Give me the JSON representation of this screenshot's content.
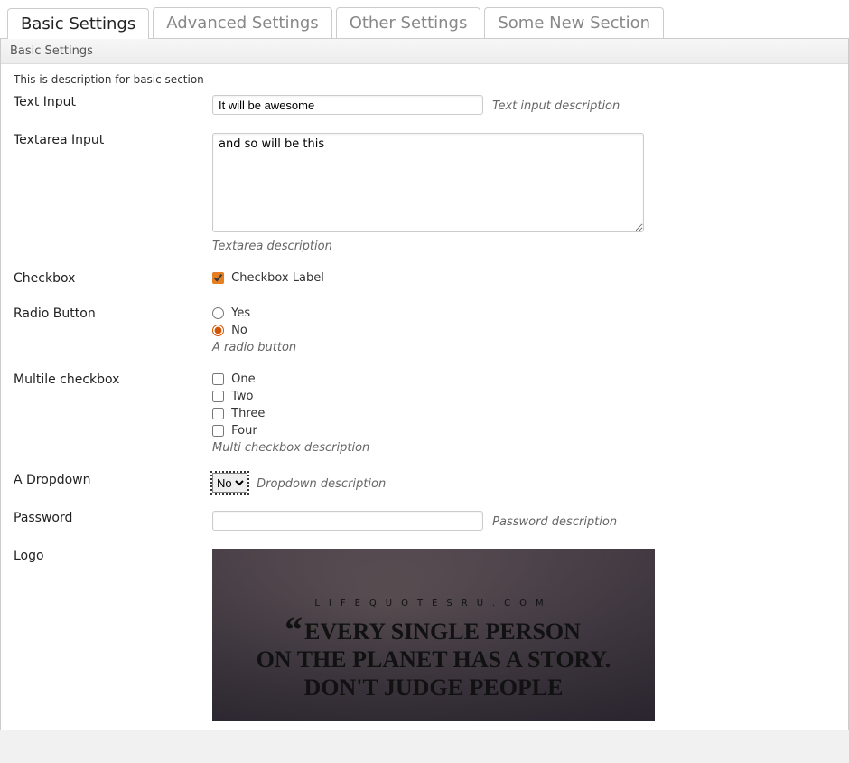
{
  "tabs": [
    {
      "label": "Basic Settings",
      "active": true
    },
    {
      "label": "Advanced Settings",
      "active": false
    },
    {
      "label": "Other Settings",
      "active": false
    },
    {
      "label": "Some New Section",
      "active": false
    }
  ],
  "section": {
    "title": "Basic Settings",
    "description": "This is description for basic section"
  },
  "fields": {
    "text": {
      "label": "Text Input",
      "value": "It will be awesome",
      "desc": "Text input description"
    },
    "textarea": {
      "label": "Textarea Input",
      "value": "and so will be this",
      "desc": "Textarea description"
    },
    "checkbox": {
      "label": "Checkbox",
      "option": "Checkbox Label",
      "checked": true
    },
    "radio": {
      "label": "Radio Button",
      "options": [
        {
          "label": "Yes",
          "checked": false
        },
        {
          "label": "No",
          "checked": true
        }
      ],
      "desc": "A radio button"
    },
    "multi": {
      "label": "Multile checkbox",
      "options": [
        {
          "label": "One",
          "checked": false
        },
        {
          "label": "Two",
          "checked": false
        },
        {
          "label": "Three",
          "checked": false
        },
        {
          "label": "Four",
          "checked": false
        }
      ],
      "desc": "Multi checkbox description"
    },
    "dropdown": {
      "label": "A Dropdown",
      "value": "No",
      "desc": "Dropdown description"
    },
    "password": {
      "label": "Password",
      "value": "",
      "desc": "Password description"
    },
    "logo": {
      "label": "Logo",
      "kicker": "LIFEQUOTESRU.COM",
      "line1": "EVERY SINGLE PERSON",
      "line2": "ON THE PLANET HAS A STORY.",
      "line3": "DON'T JUDGE PEOPLE"
    }
  }
}
